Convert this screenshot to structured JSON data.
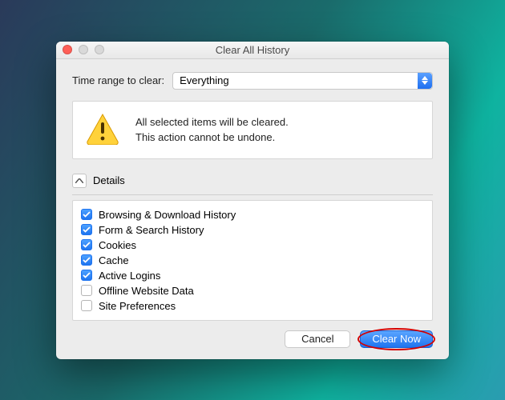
{
  "window": {
    "title": "Clear All History"
  },
  "range": {
    "label": "Time range to clear:",
    "selected": "Everything"
  },
  "warning": {
    "line1": "All selected items will be cleared.",
    "line2": "This action cannot be undone."
  },
  "details": {
    "header": "Details",
    "items": [
      {
        "label": "Browsing & Download History",
        "checked": true
      },
      {
        "label": "Form & Search History",
        "checked": true
      },
      {
        "label": "Cookies",
        "checked": true
      },
      {
        "label": "Cache",
        "checked": true
      },
      {
        "label": "Active Logins",
        "checked": true
      },
      {
        "label": "Offline Website Data",
        "checked": false
      },
      {
        "label": "Site Preferences",
        "checked": false
      }
    ]
  },
  "buttons": {
    "cancel": "Cancel",
    "clear": "Clear Now"
  }
}
